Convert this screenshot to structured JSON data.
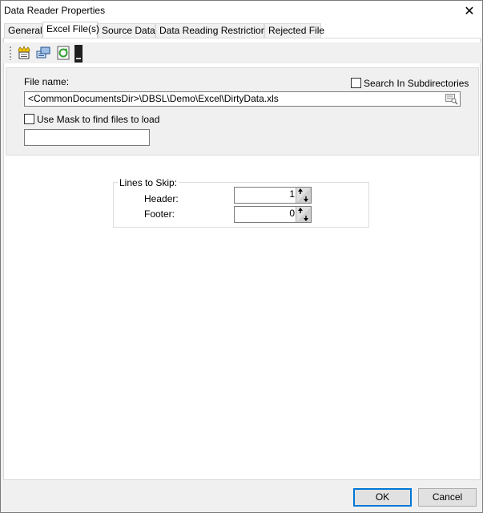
{
  "window": {
    "title": "Data Reader Properties",
    "close_glyph": "✕"
  },
  "tabs": [
    {
      "label": "General"
    },
    {
      "label": "Excel File(s)",
      "active": true
    },
    {
      "label": "Source Data"
    },
    {
      "label": "Data Reading Restrictions"
    },
    {
      "label": "Rejected File"
    }
  ],
  "toolbar": {
    "icons": [
      "add-file-icon",
      "connection-icon",
      "refresh-icon",
      "dark-panel-icon"
    ]
  },
  "file": {
    "label": "File name:",
    "value": "<CommonDocumentsDir>\\DBSL\\Demo\\Excel\\DirtyData.xls",
    "search_subdirs_label": "Search In Subdirectories",
    "search_subdirs_checked": false,
    "use_mask_label": "Use Mask to find files to load",
    "use_mask_checked": false,
    "mask_value": ""
  },
  "lines_to_skip": {
    "legend": "Lines to Skip:",
    "header_label": "Header:",
    "header_value": "1",
    "footer_label": "Footer:",
    "footer_value": "0"
  },
  "buttons": {
    "ok": "OK",
    "cancel": "Cancel"
  },
  "colors": {
    "accent": "#0078d7",
    "dialog_bg": "#f0f0f0",
    "panel_bg": "#ffffff"
  }
}
